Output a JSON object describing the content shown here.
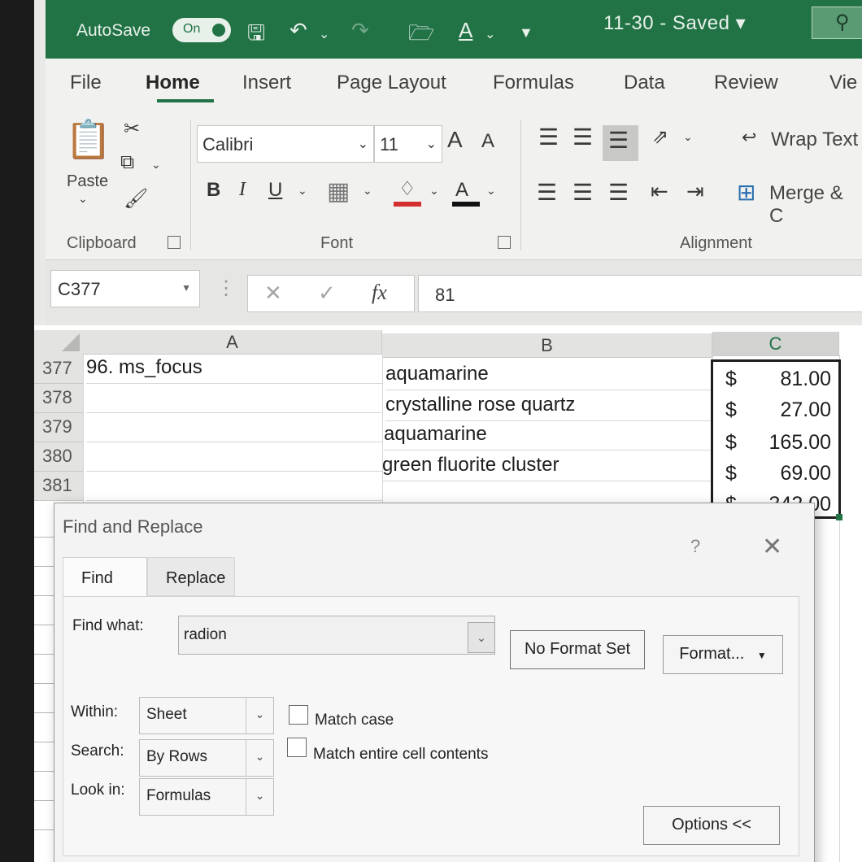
{
  "titlebar": {
    "autosave_label": "AutoSave",
    "autosave_state": "On",
    "title": "11-30  -  Saved  ▾"
  },
  "ribbon_tabs": [
    "File",
    "Home",
    "Insert",
    "Page Layout",
    "Formulas",
    "Data",
    "Review",
    "Vie"
  ],
  "clipboard": {
    "paste_label": "Paste",
    "group_label": "Clipboard"
  },
  "font": {
    "name": "Calibri",
    "size": "11",
    "group_label": "Font",
    "bold": "B",
    "italic": "I",
    "underline": "U",
    "font_color_letter": "A",
    "grow_letter": "A",
    "shrink_letter": "A"
  },
  "alignment": {
    "wrap_text_label": "Wrap Text",
    "merge_label": "Merge & C",
    "group_label": "Alignment"
  },
  "formula_bar": {
    "name_box": "C377",
    "cancel_symbol": "✕",
    "enter_symbol": "✓",
    "fx_symbol": "fx",
    "value": "81"
  },
  "sheet": {
    "columns": [
      "A",
      "B",
      "C"
    ],
    "rows": [
      {
        "num": "377",
        "a": "96. ms_focus",
        "b": "aquamarine",
        "c_symbol": "$",
        "c_value": "81.00"
      },
      {
        "num": "378",
        "a": "",
        "b": "crystalline rose quartz",
        "c_symbol": "$",
        "c_value": "27.00"
      },
      {
        "num": "379",
        "a": "",
        "b": "aquamarine",
        "c_symbol": "$",
        "c_value": "165.00"
      },
      {
        "num": "380",
        "a": "",
        "b": "green fluorite cluster",
        "c_symbol": "$",
        "c_value": "69.00"
      },
      {
        "num": "381",
        "a": "",
        "b": "",
        "c_symbol": "$",
        "c_value": "342.00"
      }
    ]
  },
  "dialog": {
    "title": "Find and Replace",
    "help": "?",
    "close": "✕",
    "tab_find": "Find",
    "tab_replace": "Replace",
    "find_what_label": "Find what:",
    "find_what_value": "radion",
    "no_format_set": "No Format Set",
    "format_button": "Format...",
    "within_label": "Within:",
    "within_value": "Sheet",
    "search_label": "Search:",
    "search_value": "By Rows",
    "lookin_label": "Look in:",
    "lookin_value": "Formulas",
    "match_case_label": "Match case",
    "match_entire_label": "Match entire cell contents",
    "options_button": "Options <<"
  },
  "colors": {
    "excel_green": "#217346",
    "font_color_red": "#d32f2f"
  },
  "icons": [
    "undo-icon",
    "save-icon",
    "open-folder-icon",
    "search-icon",
    "cut-icon",
    "copy-icon",
    "format-painter-icon",
    "borders-icon",
    "fill-color-icon",
    "align-icons",
    "orientation-icon",
    "indent-icons",
    "wrap-text-icon",
    "merge-icon",
    "chevron-down-icon",
    "close-icon"
  ]
}
